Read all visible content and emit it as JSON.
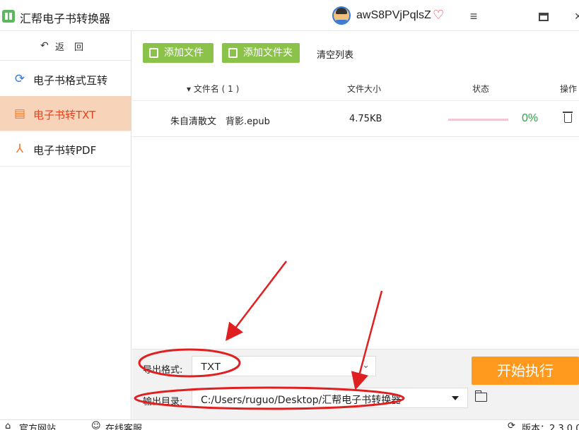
{
  "app": {
    "title": "汇帮电子书转换器",
    "username": "awS8PVjPqlsZ",
    "accent_color": "#ff9a1f",
    "green_color": "#8bc34a",
    "icons": [
      "app-logo-icon",
      "avatar-icon",
      "vip-diamond-icon",
      "menu-icon",
      "maximize-icon",
      "close-icon"
    ]
  },
  "sidebar": {
    "back_label": "返回",
    "items": [
      {
        "label": "电子书格式互转",
        "icon": "refresh-icon",
        "active": false
      },
      {
        "label": "电子书转TXT",
        "icon": "document-icon",
        "active": true
      },
      {
        "label": "电子书转PDF",
        "icon": "pdf-icon",
        "active": false
      }
    ]
  },
  "toolbar": {
    "add_file": "添加文件",
    "add_folder": "添加文件夹",
    "clear_list": "清空列表"
  },
  "table": {
    "headers": {
      "name": "▾ 文件名 ( 1 )",
      "size": "文件大小",
      "status": "状态",
      "action": "操作"
    },
    "rows": [
      {
        "name": "朱自清散文　背影.epub",
        "size": "4.75KB",
        "progress": 0,
        "percent": "0%"
      }
    ]
  },
  "settings": {
    "format_label": "导出格式:",
    "format_value": "TXT",
    "dir_label": "输出目录:",
    "dir_value": "C:/Users/ruguo/Desktop/汇帮电子书转换器",
    "start_button": "开始执行"
  },
  "footer": {
    "official_site": "官方网站",
    "online_support": "在线客服",
    "version": "版本：2.3.0.0"
  }
}
